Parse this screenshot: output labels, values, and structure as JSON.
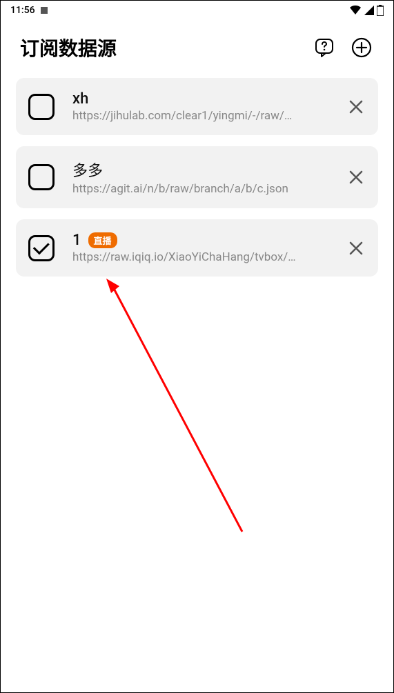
{
  "statusbar": {
    "time": "11:56"
  },
  "header": {
    "title": "订阅数据源"
  },
  "items": [
    {
      "checked": false,
      "title": "xh",
      "url": "https://jihulab.com/clear1/yingmi/-/raw/…",
      "badge": null
    },
    {
      "checked": false,
      "title": "多多",
      "url": "https://agit.ai/n/b/raw/branch/a/b/c.json",
      "badge": null
    },
    {
      "checked": true,
      "title": "1",
      "url": "https://raw.iqiq.io/XiaoYiChaHang/tvbox/…",
      "badge": "直播"
    }
  ]
}
